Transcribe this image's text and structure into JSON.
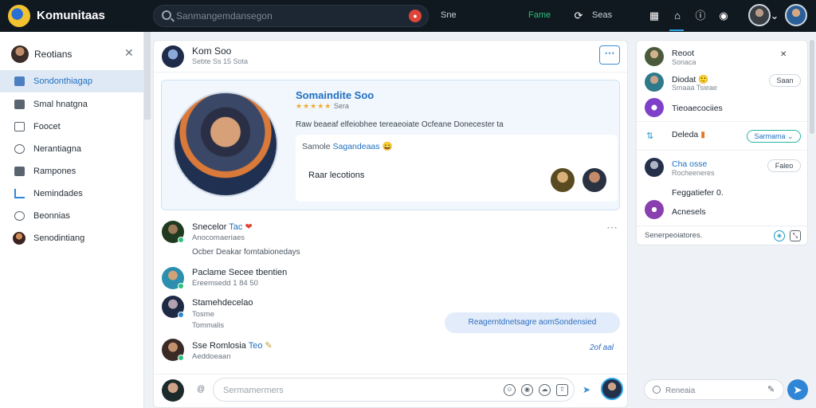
{
  "app": {
    "title": "Komunitaas"
  },
  "search": {
    "placeholder": "Sanmangemdansegon",
    "mic_icon": "mic-icon"
  },
  "topnav": {
    "item_1": "Sne",
    "item_2": "Fame",
    "item_3": "Seas"
  },
  "colors": {
    "accent": "#1f6fc2",
    "topbar": "#101820",
    "active_nav": "#27c27a",
    "online": "#27c27a"
  },
  "sidebar": {
    "header": "Reotians",
    "items": [
      {
        "label": "Sondonthiagap",
        "icon": "home-icon"
      },
      {
        "label": "Smal hnatgna",
        "icon": "briefcase-icon"
      },
      {
        "label": "Foocet",
        "icon": "play-icon"
      },
      {
        "label": "Nerantiagna",
        "icon": "user-icon"
      },
      {
        "label": "Rampones",
        "icon": "folder-icon"
      },
      {
        "label": "Nemindades",
        "icon": "chart-icon"
      },
      {
        "label": "Beonnias",
        "icon": "info-icon"
      },
      {
        "label": "Senodintiang",
        "icon": "avatar"
      }
    ]
  },
  "channel": {
    "name": "Kom Soo",
    "subtitle": "Sebte Ss 15 Sota",
    "more": "⋯"
  },
  "profile": {
    "name": "Somaindite Soo",
    "meta": "Sera",
    "stars": "★★★★★",
    "desc": "Raw beaeaf elfeiobhee tereaeoiate Ocfeane Donecester ta",
    "sample_prefix": "Samole",
    "sample_highlight": "Sagandeaas",
    "read": "Raar lecotions"
  },
  "messages": [
    {
      "name": "Snecelor",
      "tag": "Tac",
      "sub": "Anocomaeriaes",
      "body": "Ocber Deakar fomtabionedays"
    },
    {
      "name": "Paclame Secee tbentien",
      "sub": "Ereemsedd 1 84 50"
    },
    {
      "name": "Stamehdecelao",
      "sub": "Tosme",
      "body": "Tommalis"
    },
    {
      "name": "Sse Romlosia",
      "tag": "Teo",
      "sub": "Aeddoeaan"
    }
  ],
  "bubble": "Reagerntdnetsagre aomSondensied",
  "time": "2of aal",
  "composer": {
    "at": "@",
    "placeholder": "Sermamermers"
  },
  "right_panel": {
    "rows": [
      {
        "name": "Reoot",
        "sub": "Sonaca",
        "pill": ""
      },
      {
        "name": "Diodat",
        "sub": "Smaaa Tsieae",
        "pill": "Saan"
      },
      {
        "name": "Tieoaecociies",
        "sub": "",
        "pill": ""
      },
      {
        "name": "Deleda",
        "sub": "",
        "pill": "Sarmama"
      },
      {
        "name": "Cha osse",
        "sub": "Rocheeneres",
        "pill": "Faleo"
      },
      {
        "name": "Feggatiefer 0.",
        "sub": "",
        "pill": ""
      },
      {
        "name": "Acnesels",
        "sub": "",
        "pill": ""
      }
    ],
    "footer": "Senerpeoiatores."
  },
  "bottom_search": {
    "placeholder": "Reneaia"
  }
}
